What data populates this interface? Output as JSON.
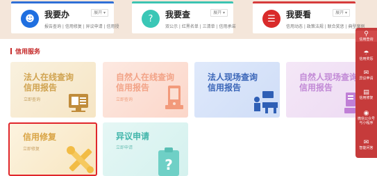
{
  "top_cards": [
    {
      "title": "我要办",
      "subtitle": "报告查询 | 信用修复 | 异议申请 | 信用授",
      "more": "展开 ▾",
      "icon": "person-icon"
    },
    {
      "title": "我要查",
      "subtitle": "双公示 | 红黑名单 | 三清单 | 信用承诺",
      "more": "展开 ▾",
      "icon": "question-icon"
    },
    {
      "title": "我要看",
      "subtitle": "信用动态 | 政策法规 | 联合奖惩 | 典型案例",
      "more": "展开 ▾",
      "icon": "book-icon"
    }
  ],
  "section": {
    "title": "信用服务"
  },
  "tiles": [
    {
      "line1": "法人在线查询",
      "line2": "信用报告",
      "link": "立即查询"
    },
    {
      "line1": "自然人在线查询",
      "line2": "信用报告",
      "link": "立即查询"
    },
    {
      "line1": "法人现场查询",
      "line2": "信用报告",
      "link": ""
    },
    {
      "line1": "自然人现场查询",
      "line2": "信用报告",
      "link": ""
    },
    {
      "line1": "信用修复",
      "line2": "",
      "link": "立即修复"
    },
    {
      "line1": "异议申请",
      "line2": "",
      "link": "立即申请"
    }
  ],
  "sidebar": [
    {
      "label": "信用查询",
      "icon": "search-icon"
    },
    {
      "label": "信用奖惩",
      "icon": "shield-icon"
    },
    {
      "label": "异议申请",
      "icon": "mail-icon"
    },
    {
      "label": "信用修复",
      "icon": "doc-icon"
    },
    {
      "label": "微信公众号\n与小程序",
      "icon": "wechat-icon"
    },
    {
      "label": "智能问答",
      "icon": "chat-icon"
    }
  ],
  "colors": {
    "accent_red": "#c52a2a",
    "blue": "#2f6fd6",
    "teal": "#3cc4b2"
  }
}
